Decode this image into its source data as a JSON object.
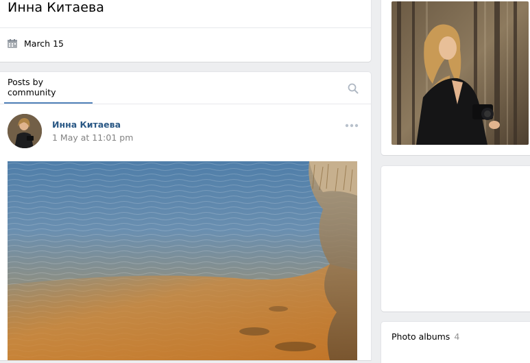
{
  "profile": {
    "name": "Инна Китаева",
    "birthday": "March 15",
    "birthday_icon": "calendar-icon"
  },
  "wall": {
    "tab_label": "Posts by community",
    "search_icon": "search-icon",
    "post": {
      "author": "Инна Китаева",
      "date": "1 May at 11:01 pm",
      "more_icon": "more-dots-icon"
    }
  },
  "sidebar": {
    "albums_label": "Photo albums",
    "albums_count": "4"
  },
  "colors": {
    "link": "#2a5885",
    "accent": "#5181b8",
    "muted": "#828282",
    "background": "#edeef0"
  }
}
